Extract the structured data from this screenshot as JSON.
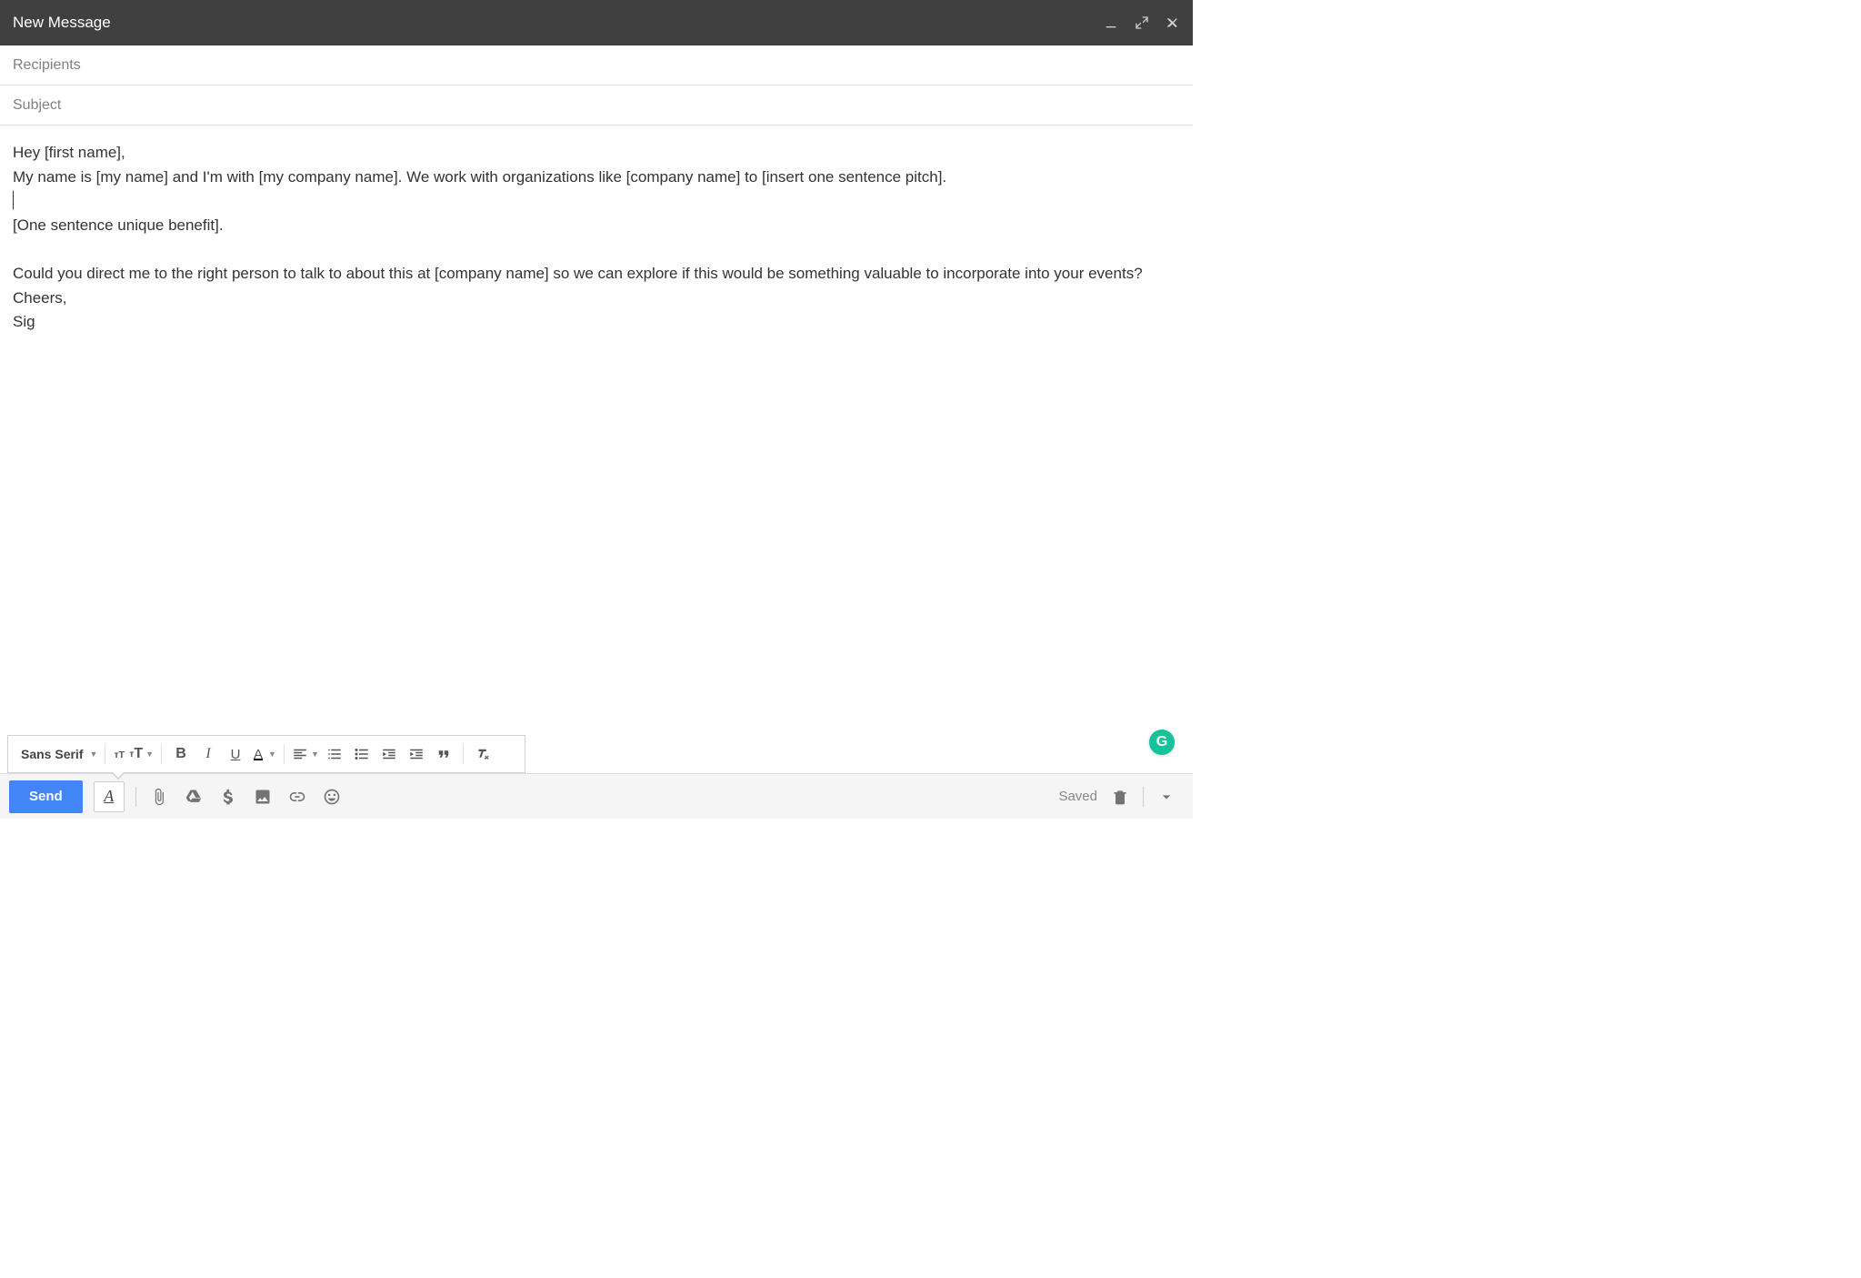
{
  "window": {
    "title": "New Message"
  },
  "fields": {
    "recipients_placeholder": "Recipients",
    "recipients_value": "",
    "subject_placeholder": "Subject",
    "subject_value": ""
  },
  "body": {
    "line1": "Hey [first name],",
    "line2": "My name is [my name] and I'm with [my company name]. We work with organizations like [company name] to [insert one sentence pitch].",
    "line3": "[One sentence unique benefit].",
    "line4": "Could you direct me to the right person to talk to about this at [company name] so we can explore if this would be something valuable to incorporate into your events?",
    "line5": "Cheers,",
    "line6": "Sig"
  },
  "format_toolbar": {
    "font_name": "Sans Serif"
  },
  "bottom": {
    "send": "Send",
    "saved": "Saved"
  }
}
